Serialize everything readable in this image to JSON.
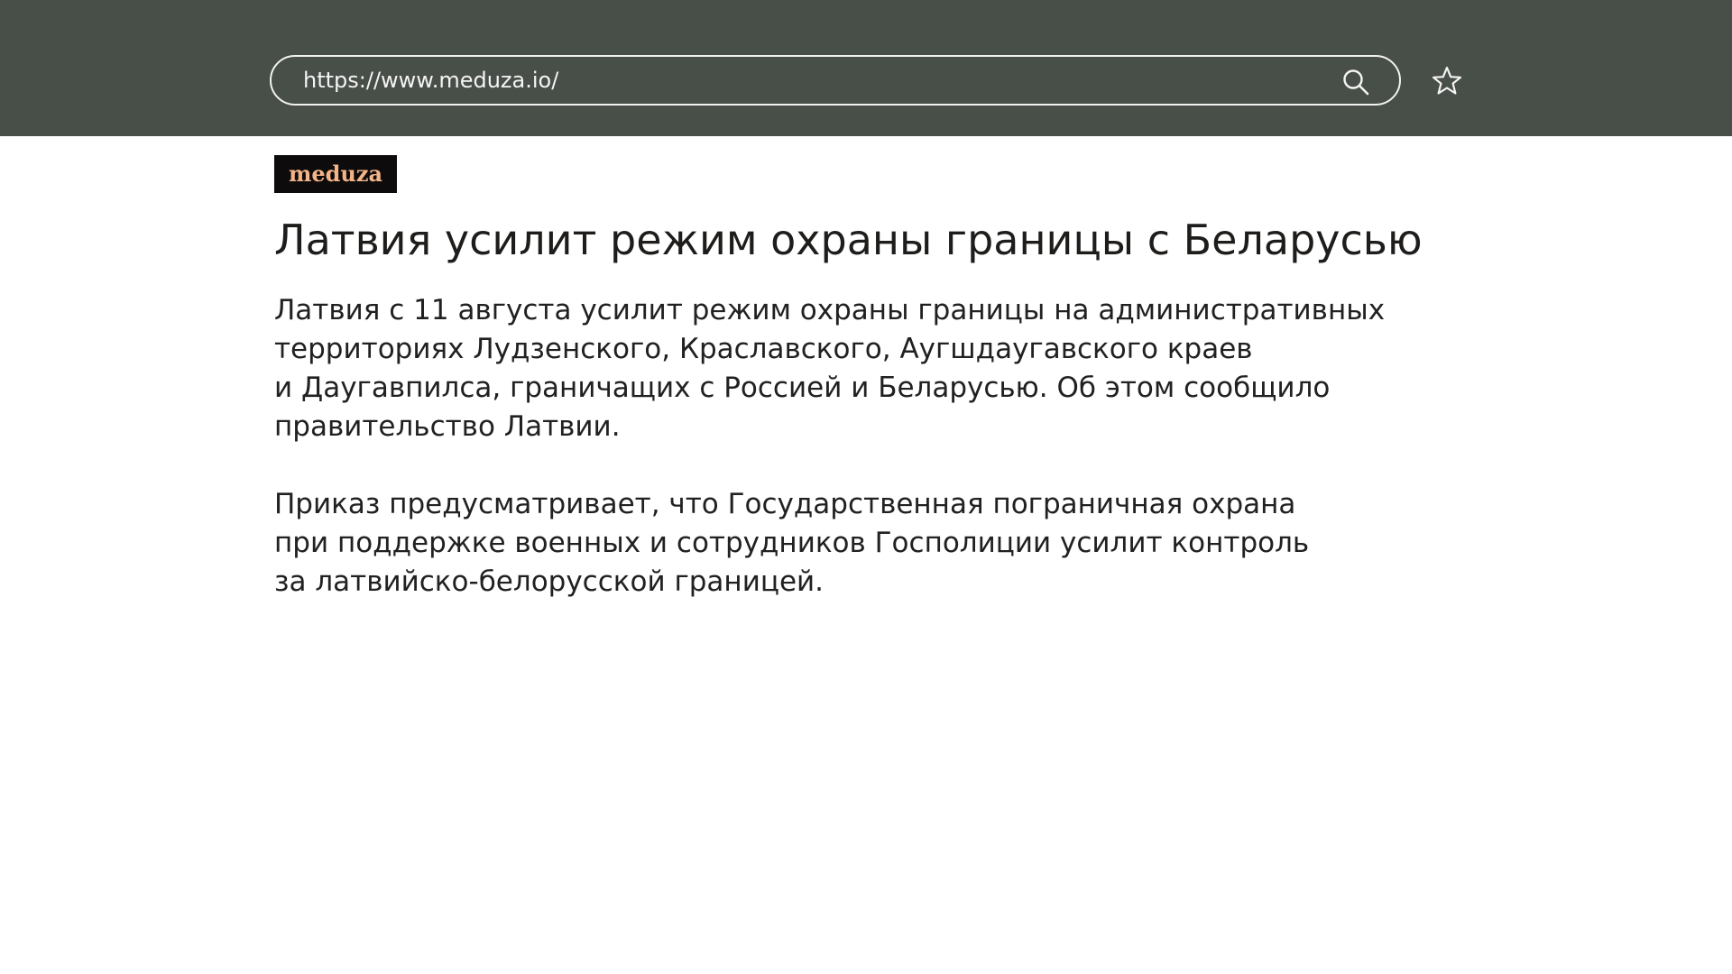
{
  "browser": {
    "url": "https://www.meduza.io/",
    "background_color": "#484e48",
    "search_icon": "search-icon",
    "bookmark_icon": "star-icon"
  },
  "site": {
    "logo_text": "meduza",
    "logo_color": "#f3b487",
    "logo_background": "#0d0b0b"
  },
  "article": {
    "headline": "Латвия усилит режим охраны границы с Беларусью",
    "paragraphs": [
      {
        "lines": [
          "Латвия с 11 августа усилит режим охраны границы на административных",
          "территориях Лудзенского, Краславского, Аугшдаугавского краев",
          "и Даугавпилса, граничащих с Россией и Беларусью. Об этом сообщило",
          "правительство Латвии."
        ]
      },
      {
        "lines": [
          "Приказ предусматривает, что Государственная пограничная охрана",
          "при поддержке военных и сотрудников Госполиции усилит контроль",
          "за латвийско-белорусской границей."
        ]
      }
    ]
  }
}
